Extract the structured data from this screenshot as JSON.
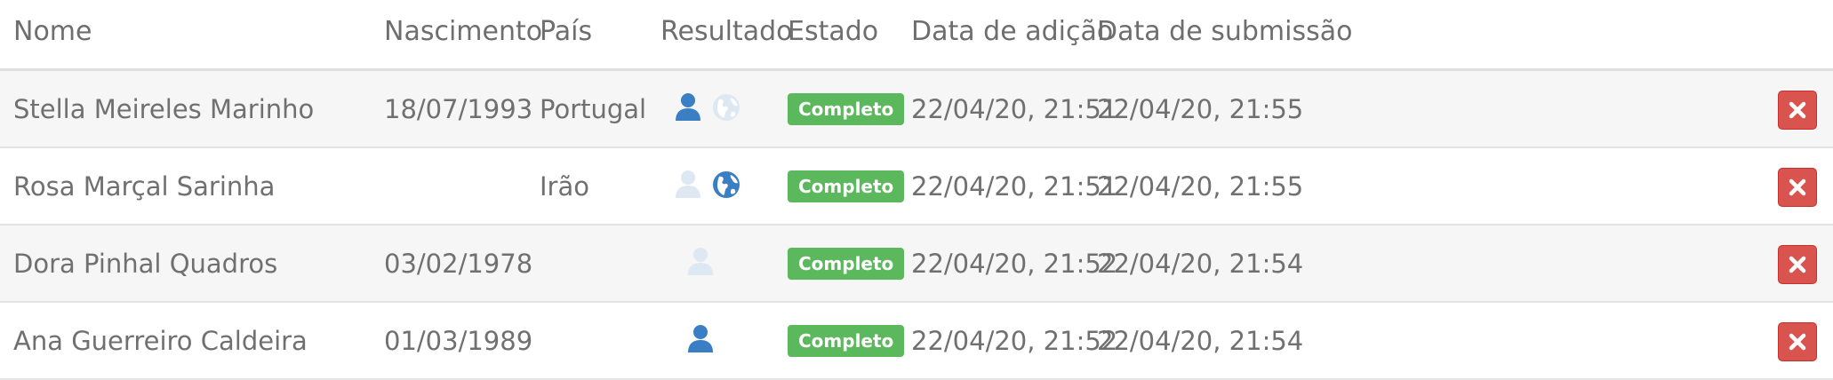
{
  "table": {
    "headers": {
      "name": "Nome",
      "birth": "Nascimento",
      "country": "País",
      "result": "Resultado",
      "state": "Estado",
      "added": "Data de adição",
      "submitted": "Data de submissão"
    },
    "rows": [
      {
        "name": "Stella Meireles Marinho",
        "birth": "18/07/1993",
        "country": "Portugal",
        "state": "Completo",
        "added": "22/04/20, 21:51",
        "submitted": "22/04/20, 21:55",
        "person_icon": "active",
        "globe_icon": "faded"
      },
      {
        "name": "Rosa Marçal Sarinha",
        "birth": "",
        "country": "Irão",
        "state": "Completo",
        "added": "22/04/20, 21:51",
        "submitted": "22/04/20, 21:55",
        "person_icon": "faded",
        "globe_icon": "active"
      },
      {
        "name": "Dora Pinhal Quadros",
        "birth": "03/02/1978",
        "country": "",
        "state": "Completo",
        "added": "22/04/20, 21:52",
        "submitted": "22/04/20, 21:54",
        "person_icon": "faded",
        "globe_icon": "none"
      },
      {
        "name": "Ana Guerreiro Caldeira",
        "birth": "01/03/1989",
        "country": "",
        "state": "Completo",
        "added": "22/04/20, 21:52",
        "submitted": "22/04/20, 21:54",
        "person_icon": "active",
        "globe_icon": "none"
      }
    ]
  },
  "icons": {
    "result_person": "person-icon",
    "result_globe": "globe-icon",
    "delete": "close-icon"
  },
  "colors": {
    "icon_active": "#3a7fc4",
    "icon_faded": "#dde8f3",
    "badge_success": "#5cb85c",
    "delete_button": "#d9534f",
    "row_stripe": "#f6f6f6"
  }
}
